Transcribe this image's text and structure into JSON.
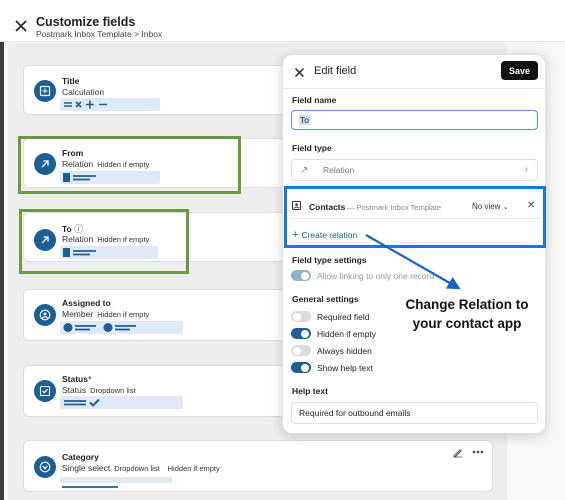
{
  "header": {
    "title": "Customize fields",
    "breadcrumb": "Postmark Inbox Template > Inbox"
  },
  "fields": [
    {
      "name": "Title",
      "type": "Calculation",
      "tags": [],
      "icon": "calculator-icon"
    },
    {
      "name": "From",
      "type": "Relation",
      "tags": [
        "Hidden if empty"
      ],
      "icon": "arrow-up-right-icon"
    },
    {
      "name": "To",
      "type": "Relation",
      "tags": [
        "Hidden if empty"
      ],
      "icon": "arrow-up-right-icon",
      "info": "ⓘ"
    },
    {
      "name": "Assigned to",
      "type": "Member",
      "tags": [
        "Hidden if empty"
      ],
      "icon": "person-icon"
    },
    {
      "name": "Status",
      "required": "*",
      "type": "Status",
      "tags": [
        "Dropdown list"
      ],
      "icon": "checkbox-icon"
    },
    {
      "name": "Category",
      "type": "Single select",
      "tags": [
        "Dropdown list",
        "Hidden if empty"
      ],
      "icon": "chevron-circle-icon"
    }
  ],
  "edit_panel": {
    "title": "Edit field",
    "save_label": "Save",
    "field_name_label": "Field name",
    "field_name_value": "To",
    "field_type_label": "Field type",
    "field_type_value": "Relation",
    "relation": {
      "app_name": "Contacts",
      "separator": "—",
      "workspace": "Postmark Inbox Template",
      "view": "No view",
      "create_label": "Create relation"
    },
    "type_settings_label": "Field type settings",
    "type_settings": [
      {
        "label": "Allow linking to only one record",
        "on": true,
        "disabled": true
      }
    ],
    "general_settings_label": "General settings",
    "general_settings": [
      {
        "label": "Required field",
        "on": false
      },
      {
        "label": "Hidden if empty",
        "on": true
      },
      {
        "label": "Always hidden",
        "on": false
      },
      {
        "label": "Show help text",
        "on": true
      }
    ],
    "help_text_label": "Help text",
    "help_text_value": "Required for outbound emails"
  },
  "annotation": {
    "line1": "Change Relation to",
    "line2": "your contact app"
  },
  "colors": {
    "accent": "#1c5f94",
    "highlight_green": "#6b9a3e",
    "highlight_blue": "#1978d4"
  }
}
